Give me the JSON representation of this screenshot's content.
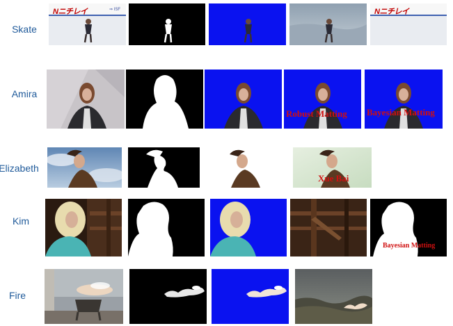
{
  "rows": [
    {
      "label": "Skate",
      "banner": "Nニチレイ",
      "banner_small": "⇒ ISF"
    },
    {
      "label": "Amira",
      "overlays": [
        "Robust Matting",
        "Bayesian Matting"
      ]
    },
    {
      "label": "Elizabeth",
      "overlays": [
        "Xue Bai"
      ]
    },
    {
      "label": "Kim",
      "overlays": [
        "Bayesian Matting"
      ]
    },
    {
      "label": "Fire"
    }
  ],
  "colors": {
    "label": "#1f5a9a",
    "composite_blue": "#0a12f0",
    "overlay_text": "#d01010"
  }
}
